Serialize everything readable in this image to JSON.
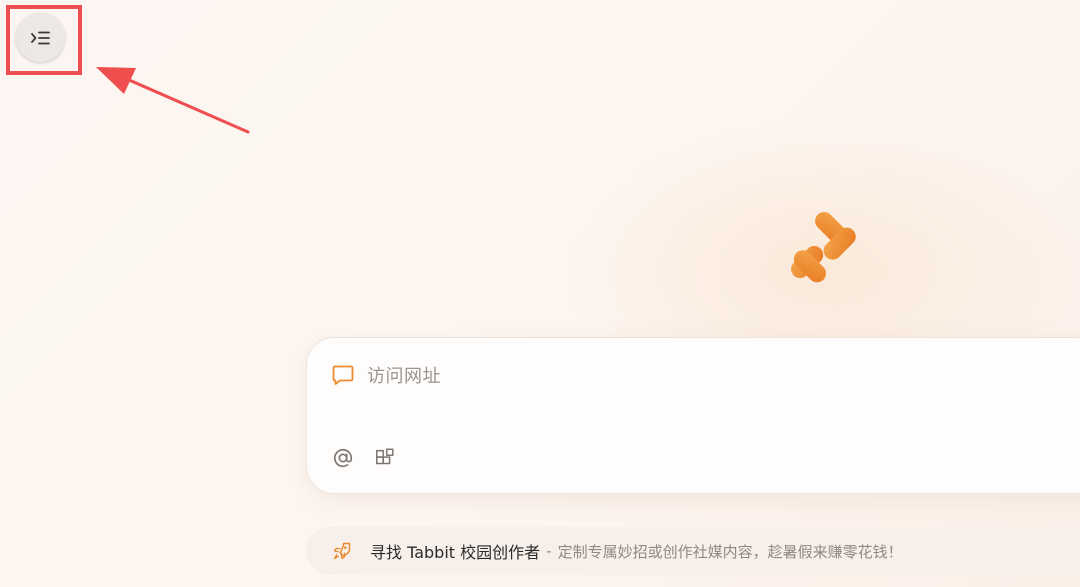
{
  "header": {
    "sidebar_toggle_icon": "sidebar-expand-icon"
  },
  "brand": {
    "logo_icon": "tabbit-logo-icon",
    "accent_color": "#ec8a2e"
  },
  "input_card": {
    "prompt_icon": "chat-bubble-icon",
    "prompt_text": "访问网址",
    "tools": [
      {
        "icon": "at-mention-icon"
      },
      {
        "icon": "apps-grid-icon"
      }
    ]
  },
  "banner": {
    "icon": "rocket-icon",
    "title": "寻找 Tabbit 校园创作者",
    "separator": "-",
    "description": "定制专属妙招或创作社媒内容，趁暑假来赚零花钱！"
  },
  "annotation": {
    "highlight_color": "#ef4e4e"
  }
}
